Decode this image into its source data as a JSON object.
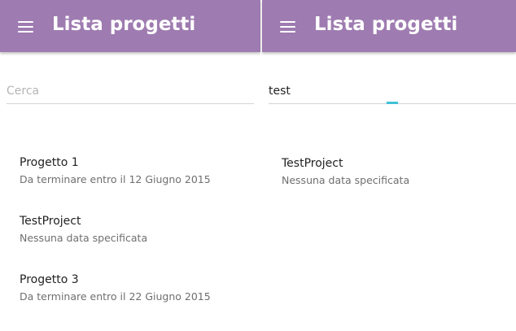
{
  "left_screen": {
    "appbar": {
      "title": "Lista progetti"
    },
    "search": {
      "value": "",
      "placeholder": "Cerca"
    },
    "projects": [
      {
        "name": "Progetto 1",
        "deadline": "Da terminare entro il 12 Giugno 2015"
      },
      {
        "name": "TestProject",
        "deadline": "Nessuna data specificata"
      },
      {
        "name": "Progetto 3",
        "deadline": "Da terminare entro il 22 Giugno 2015"
      }
    ]
  },
  "right_screen": {
    "appbar": {
      "title": "Lista progetti"
    },
    "search": {
      "value": "test",
      "placeholder": "Cerca"
    },
    "projects": [
      {
        "name": "TestProject",
        "deadline": "Nessuna data specificata"
      }
    ]
  },
  "colors": {
    "appbar": "#9e7bb0",
    "accent": "#3fc1d6",
    "primary_text": "#222222",
    "secondary_text": "#6f6f6f"
  },
  "icons": {
    "menu": "hamburger-menu-icon"
  }
}
